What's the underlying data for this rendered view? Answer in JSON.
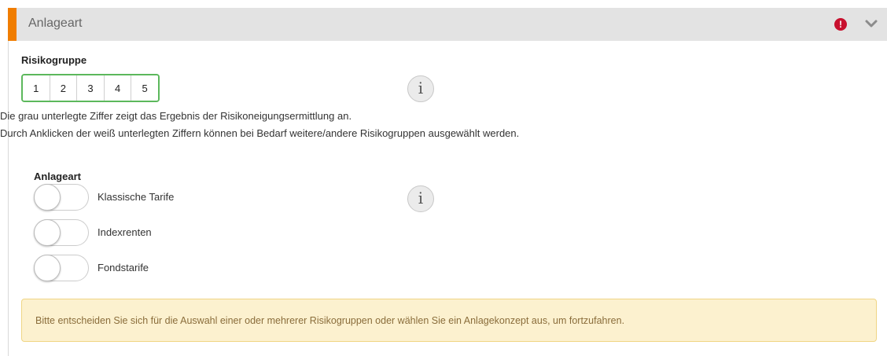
{
  "panel": {
    "title": "Anlageart",
    "accent_color": "#f07d00",
    "alert_icon": "exclamation-circle-icon",
    "alert_symbol": "!",
    "alert_color": "#c8102e",
    "collapse_icon": "chevron-down-icon"
  },
  "risk": {
    "label": "Risikogruppe",
    "options": [
      "1",
      "2",
      "3",
      "4",
      "5"
    ],
    "border_color": "#5cb85c",
    "info_symbol": "i",
    "help_line1": "Die grau unterlegte Ziffer zeigt das Ergebnis der Risikoneigungsermittlung an.",
    "help_line2": "Durch Anklicken der weiß unterlegten Ziffern können bei Bedarf weitere/andere Risikogruppen ausgewählt werden."
  },
  "anlageart": {
    "label": "Anlageart",
    "info_symbol": "i",
    "toggles": [
      {
        "label": "Klassische Tarife",
        "on": false
      },
      {
        "label": "Indexrenten",
        "on": false
      },
      {
        "label": "Fondstarife",
        "on": false
      }
    ]
  },
  "warning": {
    "text": "Bitte entscheiden Sie sich für die Auswahl einer oder mehrerer Risikogruppen oder wählen Sie ein Anlagekonzept aus, um fortzufahren.",
    "background_color": "#fcf1cf",
    "text_color": "#8a6d3b"
  }
}
